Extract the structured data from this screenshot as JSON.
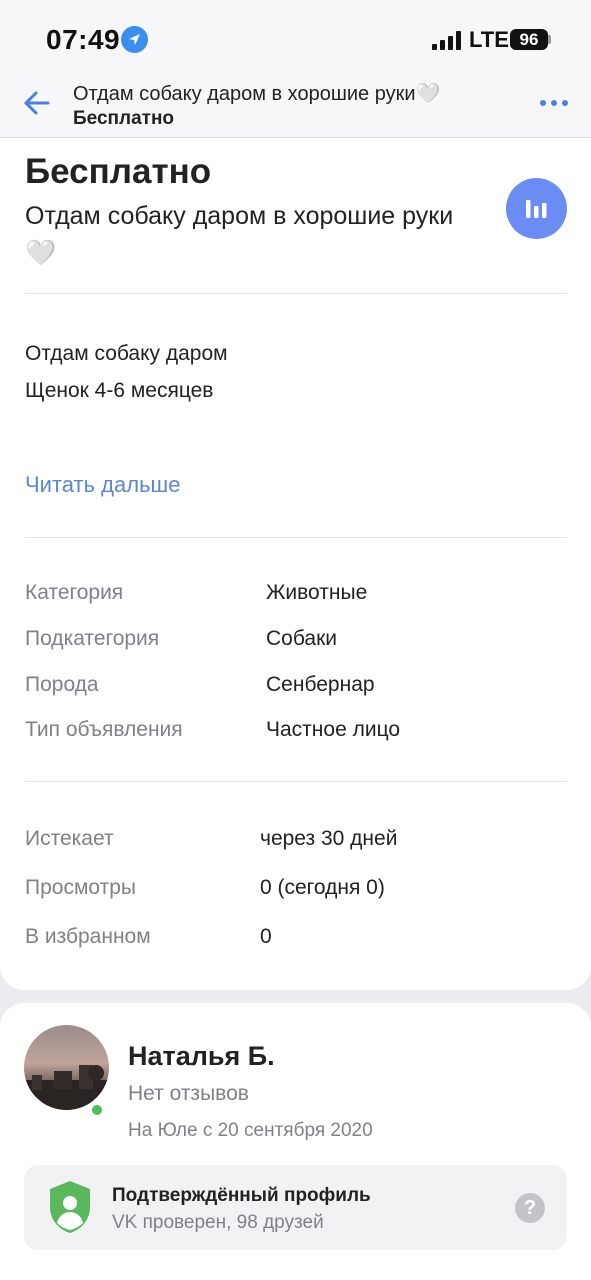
{
  "status_bar": {
    "time": "07:49",
    "network": "LTE",
    "battery": "96"
  },
  "header": {
    "title": "Отдам собаку даром в хорошие руки🤍",
    "subtitle": "Бесплатно"
  },
  "listing": {
    "price": "Бесплатно",
    "title": "Отдам собаку даром в хорошие руки🤍",
    "description": [
      "Отдам собаку даром",
      "Щенок 4-6 месяцев"
    ],
    "read_more": "Читать дальше",
    "details": [
      {
        "label": "Категория",
        "value": "Животные"
      },
      {
        "label": "Подкатегория",
        "value": "Собаки"
      },
      {
        "label": "Порода",
        "value": "Сенбернар"
      },
      {
        "label": "Тип объявления",
        "value": "Частное лицо"
      }
    ],
    "stats": [
      {
        "label": "Истекает",
        "value": "через 30 дней"
      },
      {
        "label": "Просмотры",
        "value": "0 (сегодня 0)"
      },
      {
        "label": "В избранном",
        "value": "0"
      }
    ]
  },
  "seller": {
    "name": "Наталья Б.",
    "reviews": "Нет отзывов",
    "since": "На Юле с 20 сентября 2020",
    "verified_title": "Подтверждённый профиль",
    "verified_sub": "VK проверен, 98 друзей"
  },
  "icons": {
    "back": "arrow-left-icon",
    "more": "more-dots-icon",
    "stats": "bar-chart-icon",
    "verified": "shield-user-icon",
    "help": "question-icon",
    "location": "location-arrow-icon"
  },
  "colors": {
    "accent": "#5b86d6",
    "stats_button": "#6b8cf2",
    "online": "#4cbd5a",
    "shield": "#5cb85c"
  }
}
